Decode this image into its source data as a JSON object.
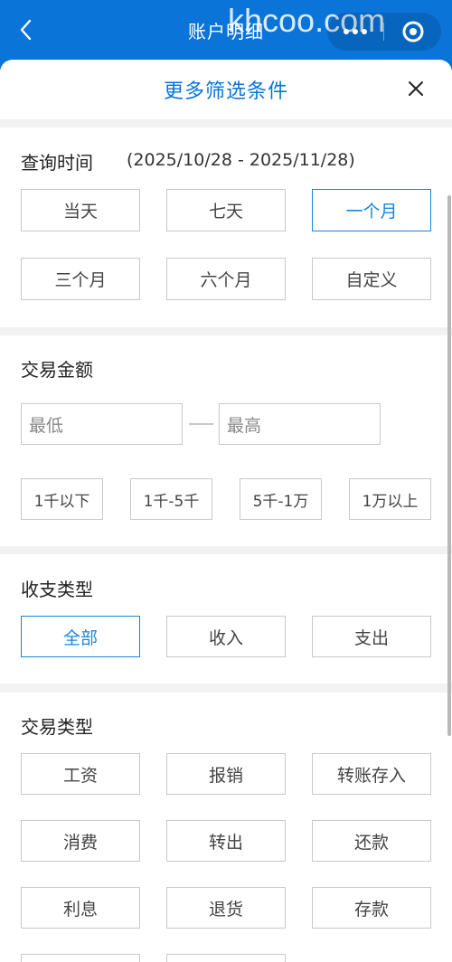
{
  "topbar": {
    "title": "账户明细",
    "watermark": "khcoo.com"
  },
  "sheet": {
    "title": "更多筛选条件"
  },
  "time": {
    "title": "查询时间",
    "range": "(2025/10/28 - 2025/11/28)",
    "options": [
      "当天",
      "七天",
      "一个月",
      "三个月",
      "六个月",
      "自定义"
    ],
    "selected": "一个月"
  },
  "amount": {
    "title": "交易金额",
    "min_placeholder": "最低",
    "max_placeholder": "最高",
    "ranges": [
      "1千以下",
      "1千-5千",
      "5千-1万",
      "1万以上"
    ]
  },
  "flow": {
    "title": "收支类型",
    "options": [
      "全部",
      "收入",
      "支出"
    ],
    "selected": "全部"
  },
  "txn": {
    "title": "交易类型",
    "options": [
      "工资",
      "报销",
      "转账存入",
      "消费",
      "转出",
      "还款",
      "利息",
      "退货",
      "存款"
    ]
  },
  "colors": {
    "accent": "#0a74d9",
    "selected": "#1a84dc",
    "border": "#c8c8c8"
  },
  "icons": {
    "back": "back-arrow-icon",
    "close": "close-icon",
    "more": "more-dots-icon",
    "target": "target-icon"
  }
}
